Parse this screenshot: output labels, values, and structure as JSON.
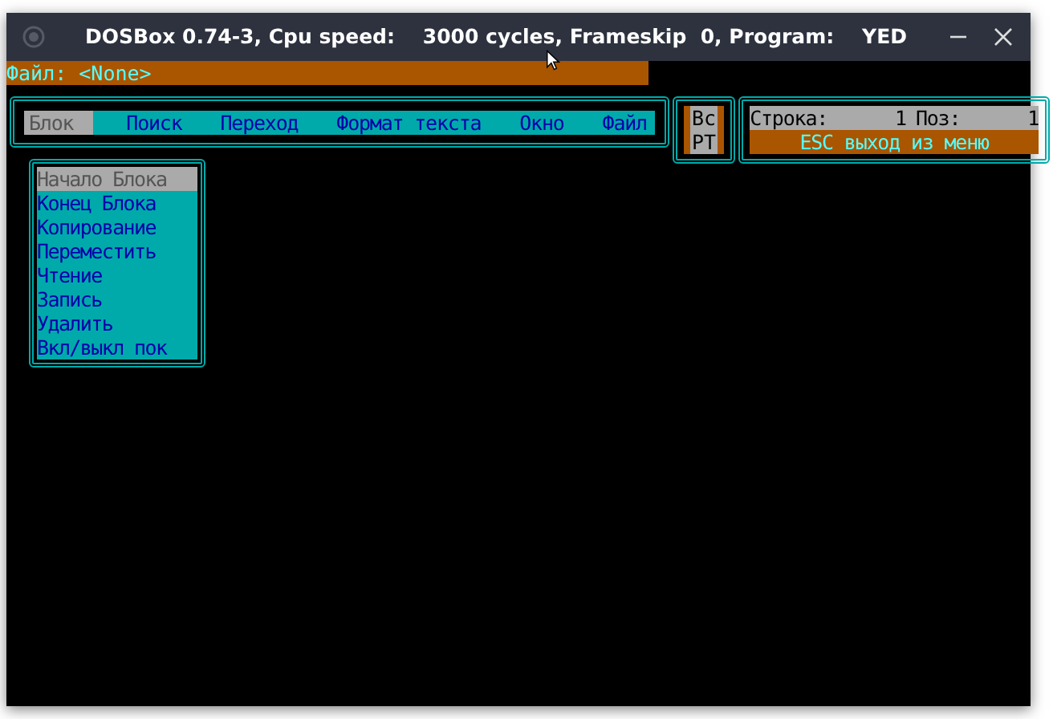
{
  "window": {
    "title": "DOSBox 0.74-3, Cpu speed:    3000 cycles, Frameskip  0, Program:    YED"
  },
  "file_bar": {
    "text": "Файл: <None>"
  },
  "menu": [
    {
      "label": "Блок",
      "selected": true
    },
    {
      "label": "Поиск",
      "selected": false
    },
    {
      "label": "Переход",
      "selected": false
    },
    {
      "label": "Формат текста",
      "selected": false
    },
    {
      "label": "Окно",
      "selected": false
    },
    {
      "label": "Файл",
      "selected": false
    }
  ],
  "mode_box": [
    "Вс",
    "РТ"
  ],
  "status": {
    "line_label": "Строка:",
    "line_value": "1",
    "pos_label": "Поз:",
    "pos_value": "1",
    "hint": "ESC выход из меню"
  },
  "dropdown": [
    {
      "label": "Начало Блока",
      "selected": true
    },
    {
      "label": "Конец Блока",
      "selected": false
    },
    {
      "label": "Копирование",
      "selected": false
    },
    {
      "label": "Переместить",
      "selected": false
    },
    {
      "label": "Чтение",
      "selected": false
    },
    {
      "label": "Запись",
      "selected": false
    },
    {
      "label": "Удалить",
      "selected": false
    },
    {
      "label": "Вкл/выкл пок",
      "selected": false
    }
  ]
}
